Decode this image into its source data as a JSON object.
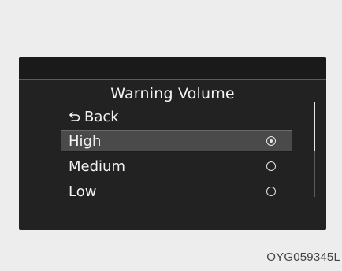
{
  "screen": {
    "title": "Warning Volume",
    "back_label": "Back",
    "back_icon": "back-arrow-icon",
    "options": [
      {
        "label": "High",
        "selected": true
      },
      {
        "label": "Medium",
        "selected": false
      },
      {
        "label": "Low",
        "selected": false
      }
    ]
  },
  "figure_code": "OYG059345L",
  "colors": {
    "screen_bg": "#222222",
    "highlight": "#4a4a4a",
    "text": "#f2f2f2",
    "page_bg": "#ededed"
  }
}
